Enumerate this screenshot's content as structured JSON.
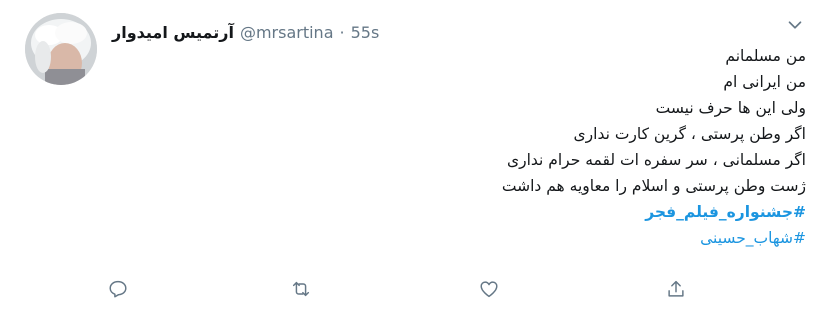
{
  "tweet": {
    "author": {
      "display_name": "آرتمیس امیدوار",
      "handle": "@mrsartina",
      "separator": "·",
      "timestamp": "55s"
    },
    "body_lines": [
      "من مسلمانم",
      "من ایرانی ام",
      "ولی این ها حرف نیست",
      "اگر وطن پرستی ، گرین کارت نداری",
      "اگر مسلمانی ، سر سفره ات لقمه حرام نداری",
      "ژست وطن پرستی و اسلام را معاویه هم داشت"
    ],
    "hashtags": [
      "#جشنواره_فیلم_فجر",
      "#شهاب_حسینی"
    ]
  },
  "colors": {
    "link": "#1b95e0",
    "secondary_text": "#657786",
    "primary_text": "#14171a"
  },
  "icons": {
    "caret": "chevron-down-icon",
    "reply": "reply-icon",
    "retweet": "retweet-icon",
    "like": "heart-icon",
    "share": "share-icon"
  }
}
